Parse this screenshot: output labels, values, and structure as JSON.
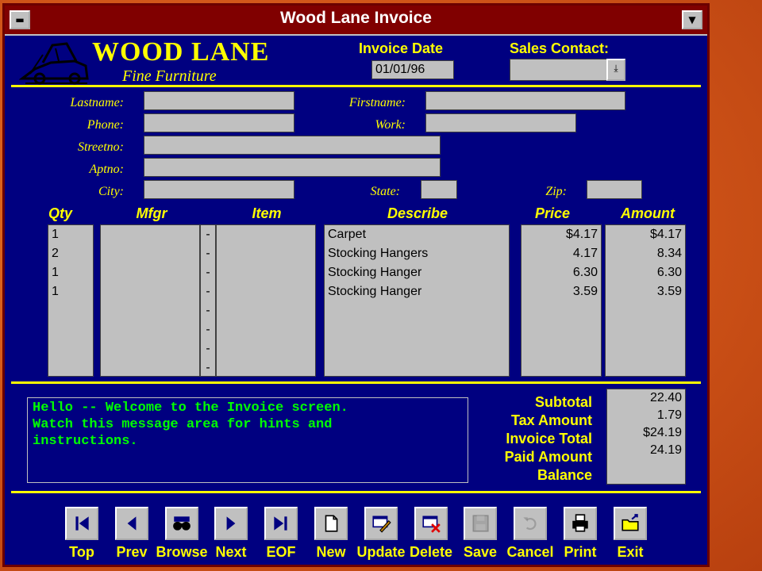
{
  "window": {
    "title": "Wood Lane Invoice"
  },
  "logo": {
    "main": "WOOD LANE",
    "sub": "Fine Furniture"
  },
  "header": {
    "invoice_date_label": "Invoice Date",
    "invoice_date_value": "01/01/96",
    "sales_contact_label": "Sales Contact:",
    "sales_contact_value": ""
  },
  "customer": {
    "lastname_label": "Lastname:",
    "firstname_label": "Firstname:",
    "phone_label": "Phone:",
    "work_label": "Work:",
    "streetno_label": "Streetno:",
    "aptno_label": "Aptno:",
    "city_label": "City:",
    "state_label": "State:",
    "zip_label": "Zip:",
    "lastname": "",
    "firstname": "",
    "phone": "",
    "work": "",
    "streetno": "",
    "aptno": "",
    "city": "",
    "state": "",
    "zip": ""
  },
  "items": {
    "headers": {
      "qty": "Qty",
      "mfgr": "Mfgr",
      "item": "Item",
      "describe": "Describe",
      "price": "Price",
      "amount": "Amount"
    },
    "separator": "-",
    "rows": [
      {
        "qty": "1",
        "mfgr": "",
        "item": "",
        "describe": "Carpet",
        "price": "$4.17",
        "amount": "$4.17"
      },
      {
        "qty": "2",
        "mfgr": "",
        "item": "",
        "describe": "Stocking Hangers",
        "price": "4.17",
        "amount": "8.34"
      },
      {
        "qty": "1",
        "mfgr": "",
        "item": "",
        "describe": "Stocking Hanger",
        "price": "6.30",
        "amount": "6.30"
      },
      {
        "qty": "1",
        "mfgr": "",
        "item": "",
        "describe": "Stocking Hanger",
        "price": "3.59",
        "amount": "3.59"
      }
    ]
  },
  "message": "Hello -- Welcome to the Invoice screen.\nWatch this message area for hints and\ninstructions.",
  "totals": {
    "subtotal_label": "Subtotal",
    "tax_label": "Tax Amount",
    "invoice_total_label": "Invoice Total",
    "paid_label": "Paid Amount",
    "balance_label": "Balance",
    "subtotal": "22.40",
    "tax": "1.79",
    "invoice_total": "$24.19",
    "paid": "24.19",
    "balance": ""
  },
  "toolbar": [
    {
      "label": "Top",
      "icon": "first-record-icon",
      "enabled": true
    },
    {
      "label": "Prev",
      "icon": "prev-record-icon",
      "enabled": true
    },
    {
      "label": "Browse",
      "icon": "binoculars-icon",
      "enabled": true
    },
    {
      "label": "Next",
      "icon": "next-record-icon",
      "enabled": true
    },
    {
      "label": "EOF",
      "icon": "last-record-icon",
      "enabled": true
    },
    {
      "label": "New",
      "icon": "new-page-icon",
      "enabled": true
    },
    {
      "label": "Update",
      "icon": "edit-pencil-icon",
      "enabled": true
    },
    {
      "label": "Delete",
      "icon": "delete-x-icon",
      "enabled": true
    },
    {
      "label": "Save",
      "icon": "floppy-disk-icon",
      "enabled": false
    },
    {
      "label": "Cancel",
      "icon": "undo-arrow-icon",
      "enabled": false
    },
    {
      "label": "Print",
      "icon": "printer-icon",
      "enabled": true
    },
    {
      "label": "Exit",
      "icon": "exit-door-icon",
      "enabled": true
    }
  ],
  "colors": {
    "window_bg": "#000080",
    "title_bg": "#800000",
    "label": "#ffff00",
    "message": "#00ff00",
    "field": "#c0c0c0"
  }
}
